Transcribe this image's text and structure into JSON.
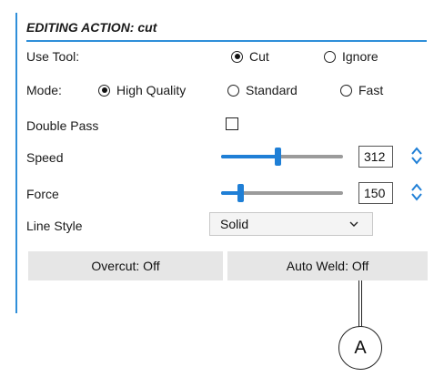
{
  "panel": {
    "header": "EDITING ACTION: cut",
    "use_tool": {
      "label": "Use Tool:",
      "options": [
        {
          "label": "Cut",
          "selected": true
        },
        {
          "label": "Ignore",
          "selected": false
        }
      ]
    },
    "mode": {
      "label": "Mode:",
      "options": [
        {
          "label": "High Quality",
          "selected": true
        },
        {
          "label": "Standard",
          "selected": false
        },
        {
          "label": "Fast",
          "selected": false
        }
      ]
    },
    "double_pass": {
      "label": "Double Pass",
      "checked": false
    },
    "speed": {
      "label": "Speed",
      "value": "312",
      "slider_fraction": 0.46
    },
    "force": {
      "label": "Force",
      "value": "150",
      "slider_fraction": 0.16
    },
    "line_style": {
      "label": "Line Style",
      "value": "Solid"
    },
    "buttons": {
      "overcut": "Overcut: Off",
      "auto_weld": "Auto Weld: Off"
    }
  },
  "callout": {
    "label": "A"
  },
  "colors": {
    "accent": "#2f8fd9",
    "slider": "#1f7fd6",
    "button_bg": "#e6e6e6"
  }
}
